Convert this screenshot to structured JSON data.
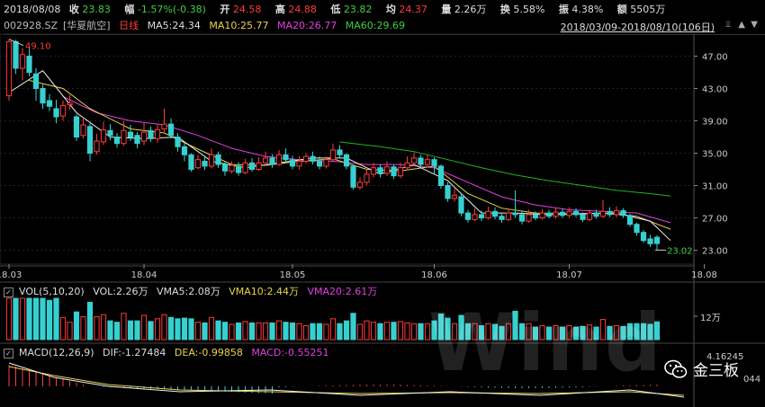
{
  "header": {
    "date": "2018/08/08",
    "close_label": "收",
    "close": "23.83",
    "chg_label": "幅",
    "chg": "-1.57%(-0.38)",
    "open_label": "开",
    "open": "24.58",
    "high_label": "高",
    "high": "24.88",
    "low_label": "低",
    "low": "23.82",
    "avg_label": "均",
    "avg": "24.37",
    "vol_label": "量",
    "vol": "2.26万",
    "turn_label": "换",
    "turn": "5.58%",
    "amp_label": "振",
    "amp": "4.38%",
    "amt_label": "额",
    "amt": "5505万"
  },
  "info": {
    "code": "002928.SZ",
    "name": "[华夏航空]",
    "period": "日线",
    "ma5": "MA5:24.34",
    "ma10": "MA10:25.77",
    "ma20": "MA20:26.77",
    "ma60": "MA60:29.69",
    "range": "2018/03/09-2018/08/10(106日)"
  },
  "volume": {
    "title": "VOL(5,10,20)",
    "vol": "VOL:2.26万",
    "vma5": "VMA5:2.08万",
    "vma10": "VMA10:2.44万",
    "vma20": "VMA20:2.61万",
    "axis_label": "12万"
  },
  "macd": {
    "title": "MACD(12,26,9)",
    "dif": "DIF:-1.27484",
    "dea": "DEA:-0.99858",
    "macd": "MACD:-0.55251",
    "axis_top": "4.16245",
    "axis_bottom": "044"
  },
  "watermark": {
    "logo": "Wind",
    "brand": "金三板"
  },
  "colors": {
    "up": "#ff3b3b",
    "down": "#36d0d0",
    "ma5": "#f0f0f0",
    "ma10": "#e8d44a",
    "ma20": "#e040e0",
    "ma60": "#22b322"
  },
  "chart_data": {
    "type": "candlestick",
    "y_ticks": [
      23.0,
      27.0,
      31.0,
      35.0,
      39.0,
      43.0,
      47.0
    ],
    "ylim": [
      21.5,
      49.5
    ],
    "x_tick_labels": [
      "18.03",
      "18.04",
      "18.05",
      "18.06",
      "18.07",
      "18.08"
    ],
    "x_tick_index": [
      0,
      20,
      42,
      63,
      83,
      103
    ],
    "max_label": "49.10",
    "min_label": "23.02",
    "candles": [
      [
        42.1,
        48.8,
        49.1,
        41.5
      ],
      [
        48.8,
        45.5,
        49.0,
        44.8
      ],
      [
        45.5,
        47.2,
        48.0,
        44.0
      ],
      [
        47.0,
        45.0,
        48.2,
        44.5
      ],
      [
        44.8,
        43.0,
        45.5,
        41.5
      ],
      [
        43.0,
        41.2,
        43.5,
        40.5
      ],
      [
        41.5,
        40.8,
        42.3,
        40.2
      ],
      [
        40.5,
        39.5,
        41.6,
        38.7
      ],
      [
        39.6,
        40.9,
        41.5,
        39.0
      ],
      [
        41.0,
        41.2,
        42.2,
        40.4
      ],
      [
        39.5,
        37.0,
        39.8,
        36.5
      ],
      [
        37.2,
        38.5,
        39.4,
        36.8
      ],
      [
        38.3,
        35.0,
        38.7,
        34.0
      ],
      [
        35.2,
        36.5,
        37.4,
        34.8
      ],
      [
        36.4,
        37.9,
        38.9,
        36.0
      ],
      [
        37.8,
        37.2,
        38.6,
        36.6
      ],
      [
        37.0,
        36.2,
        37.5,
        35.7
      ],
      [
        36.2,
        37.8,
        39.0,
        35.9
      ],
      [
        37.6,
        37.0,
        38.5,
        36.5
      ],
      [
        37.2,
        36.2,
        37.6,
        35.6
      ],
      [
        36.5,
        37.6,
        38.8,
        36.0
      ],
      [
        37.8,
        36.8,
        38.3,
        36.4
      ],
      [
        36.8,
        37.9,
        38.6,
        36.3
      ],
      [
        38.0,
        38.6,
        40.5,
        37.6
      ],
      [
        38.6,
        37.2,
        39.3,
        36.8
      ],
      [
        37.0,
        35.8,
        37.5,
        35.2
      ],
      [
        35.8,
        34.8,
        36.4,
        34.0
      ],
      [
        34.8,
        33.0,
        35.0,
        32.7
      ],
      [
        33.2,
        34.2,
        34.8,
        33.0
      ],
      [
        34.0,
        33.4,
        34.6,
        32.9
      ],
      [
        33.4,
        34.8,
        35.6,
        33.1
      ],
      [
        34.8,
        33.6,
        35.2,
        33.2
      ],
      [
        33.6,
        32.8,
        34.0,
        32.2
      ],
      [
        32.8,
        33.5,
        34.0,
        32.5
      ],
      [
        33.4,
        32.6,
        33.9,
        32.2
      ],
      [
        32.6,
        33.8,
        34.3,
        32.4
      ],
      [
        33.8,
        33.0,
        34.4,
        32.7
      ],
      [
        33.0,
        33.8,
        34.5,
        32.8
      ],
      [
        33.8,
        34.4,
        35.2,
        33.5
      ],
      [
        34.4,
        33.6,
        34.9,
        33.2
      ],
      [
        33.6,
        34.8,
        35.4,
        33.4
      ],
      [
        34.8,
        34.2,
        35.6,
        33.8
      ],
      [
        34.2,
        33.4,
        34.7,
        33.0
      ],
      [
        33.4,
        34.0,
        34.6,
        33.0
      ],
      [
        34.0,
        34.6,
        35.0,
        33.7
      ],
      [
        34.6,
        34.0,
        35.2,
        33.6
      ],
      [
        34.0,
        33.4,
        34.6,
        33.0
      ],
      [
        33.4,
        34.2,
        34.6,
        33.1
      ],
      [
        34.2,
        35.4,
        36.2,
        33.9
      ],
      [
        35.4,
        34.8,
        36.0,
        34.4
      ],
      [
        34.8,
        33.4,
        35.0,
        33.0
      ],
      [
        33.4,
        30.8,
        33.6,
        30.5
      ],
      [
        30.8,
        31.4,
        32.0,
        30.5
      ],
      [
        31.4,
        32.4,
        33.0,
        31.0
      ],
      [
        32.4,
        33.2,
        33.8,
        32.0
      ],
      [
        33.2,
        32.5,
        33.6,
        32.0
      ],
      [
        32.5,
        33.3,
        34.0,
        32.2
      ],
      [
        33.3,
        32.2,
        33.6,
        31.8
      ],
      [
        32.2,
        33.2,
        33.8,
        31.9
      ],
      [
        33.2,
        33.8,
        34.6,
        32.9
      ],
      [
        33.8,
        34.4,
        35.1,
        33.5
      ],
      [
        34.4,
        33.6,
        34.8,
        33.2
      ],
      [
        33.6,
        34.2,
        34.8,
        33.2
      ],
      [
        34.2,
        33.4,
        34.5,
        32.5
      ],
      [
        33.4,
        31.0,
        33.6,
        30.6
      ],
      [
        31.0,
        29.4,
        31.4,
        29.0
      ],
      [
        29.4,
        29.8,
        30.6,
        29.0
      ],
      [
        29.6,
        27.6,
        30.0,
        27.2
      ],
      [
        27.6,
        26.8,
        28.0,
        26.4
      ],
      [
        26.8,
        27.4,
        28.2,
        26.6
      ],
      [
        27.4,
        27.0,
        27.9,
        26.6
      ],
      [
        27.0,
        27.8,
        28.4,
        26.8
      ],
      [
        27.8,
        27.2,
        28.3,
        26.8
      ],
      [
        27.2,
        26.8,
        27.6,
        26.4
      ],
      [
        26.8,
        27.6,
        28.2,
        26.6
      ],
      [
        27.6,
        27.4,
        30.4,
        27.0
      ],
      [
        27.4,
        26.6,
        27.8,
        26.2
      ],
      [
        26.6,
        27.4,
        28.0,
        26.4
      ],
      [
        27.4,
        27.0,
        27.8,
        26.7
      ],
      [
        27.0,
        27.6,
        28.1,
        26.8
      ],
      [
        27.6,
        27.2,
        28.0,
        26.9
      ],
      [
        27.2,
        27.7,
        28.2,
        26.9
      ],
      [
        27.7,
        27.3,
        28.1,
        27.0
      ],
      [
        27.3,
        27.8,
        28.3,
        27.0
      ],
      [
        27.8,
        27.4,
        28.2,
        27.1
      ],
      [
        27.4,
        26.8,
        27.7,
        26.5
      ],
      [
        26.8,
        27.6,
        28.0,
        26.6
      ],
      [
        27.6,
        27.2,
        28.0,
        26.9
      ],
      [
        27.2,
        27.8,
        29.2,
        27.0
      ],
      [
        27.8,
        27.4,
        28.3,
        27.1
      ],
      [
        27.4,
        27.9,
        28.4,
        27.1
      ],
      [
        27.9,
        27.3,
        28.2,
        27.0
      ],
      [
        27.3,
        26.2,
        27.5,
        25.9
      ],
      [
        26.2,
        25.2,
        26.4,
        24.8
      ],
      [
        25.2,
        24.2,
        25.5,
        23.9
      ],
      [
        24.4,
        23.8,
        24.9,
        23.4
      ],
      [
        24.6,
        23.83,
        24.88,
        23.02
      ]
    ],
    "ma5": [
      [
        0,
        42.5
      ],
      [
        5,
        45.2
      ],
      [
        10,
        40.0
      ],
      [
        15,
        37.0
      ],
      [
        20,
        36.8
      ],
      [
        25,
        37.0
      ],
      [
        30,
        34.0
      ],
      [
        35,
        33.2
      ],
      [
        40,
        33.8
      ],
      [
        45,
        34.4
      ],
      [
        50,
        34.4
      ],
      [
        55,
        32.4
      ],
      [
        60,
        33.6
      ],
      [
        65,
        31.6
      ],
      [
        70,
        27.6
      ],
      [
        75,
        27.6
      ],
      [
        80,
        27.4
      ],
      [
        85,
        27.5
      ],
      [
        90,
        27.6
      ],
      [
        95,
        26.6
      ],
      [
        98,
        24.2
      ]
    ],
    "ma10": [
      [
        3,
        44.0
      ],
      [
        8,
        43.0
      ],
      [
        12,
        40.5
      ],
      [
        18,
        38.0
      ],
      [
        23,
        37.5
      ],
      [
        28,
        35.5
      ],
      [
        33,
        33.6
      ],
      [
        38,
        33.5
      ],
      [
        43,
        34.0
      ],
      [
        48,
        34.3
      ],
      [
        53,
        33.0
      ],
      [
        58,
        32.8
      ],
      [
        63,
        33.4
      ],
      [
        68,
        30.0
      ],
      [
        73,
        28.2
      ],
      [
        78,
        27.6
      ],
      [
        83,
        27.5
      ],
      [
        88,
        27.6
      ],
      [
        93,
        27.2
      ],
      [
        98,
        25.6
      ]
    ],
    "ma20": [
      [
        8,
        42.0
      ],
      [
        13,
        40.0
      ],
      [
        18,
        39.0
      ],
      [
        23,
        38.5
      ],
      [
        28,
        37.2
      ],
      [
        33,
        35.6
      ],
      [
        38,
        34.6
      ],
      [
        43,
        34.2
      ],
      [
        48,
        34.0
      ],
      [
        53,
        33.6
      ],
      [
        58,
        33.6
      ],
      [
        63,
        33.2
      ],
      [
        68,
        31.4
      ],
      [
        73,
        29.6
      ],
      [
        78,
        28.6
      ],
      [
        83,
        28.0
      ],
      [
        88,
        27.8
      ],
      [
        93,
        27.6
      ],
      [
        98,
        26.4
      ]
    ],
    "ma60": [
      [
        49,
        36.4
      ],
      [
        55,
        35.8
      ],
      [
        60,
        35.2
      ],
      [
        65,
        34.2
      ],
      [
        70,
        33.2
      ],
      [
        75,
        32.3
      ],
      [
        80,
        31.6
      ],
      [
        85,
        31.0
      ],
      [
        90,
        30.4
      ],
      [
        95,
        30.0
      ],
      [
        98,
        29.69
      ]
    ]
  }
}
